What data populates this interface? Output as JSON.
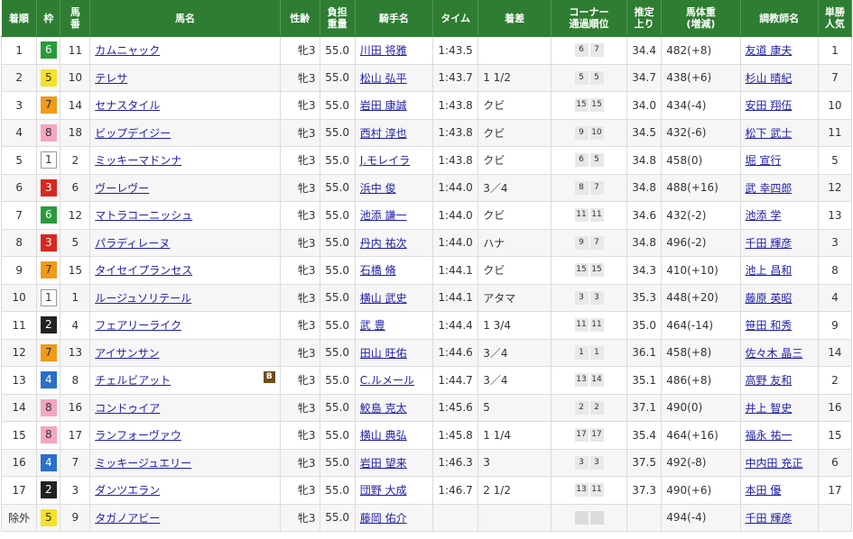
{
  "headers": {
    "rank": "着順",
    "waku": "枠",
    "umaban": "馬番",
    "horse": "馬名",
    "sex_age": "性齢",
    "weight_carried": "負担重量",
    "jockey": "騎手名",
    "time": "タイム",
    "margin": "着差",
    "corner": "コーナー通過順位",
    "last3f": "推定上り",
    "body_weight": "馬体重(増減)",
    "trainer": "調教師名",
    "popularity": "単勝人気"
  },
  "waku_colors": {
    "1": {
      "bg": "#ffffff",
      "fg": "#333333",
      "border": "#999999"
    },
    "2": {
      "bg": "#222222",
      "fg": "#ffffff",
      "border": "#222222"
    },
    "3": {
      "bg": "#d8281f",
      "fg": "#ffffff",
      "border": "#d8281f"
    },
    "4": {
      "bg": "#2a6fc9",
      "fg": "#ffffff",
      "border": "#2a6fc9"
    },
    "5": {
      "bg": "#f5e02a",
      "fg": "#333333",
      "border": "#f5e02a"
    },
    "6": {
      "bg": "#2a9a3a",
      "fg": "#ffffff",
      "border": "#2a9a3a"
    },
    "7": {
      "bg": "#f09a1a",
      "fg": "#333333",
      "border": "#f09a1a"
    },
    "8": {
      "bg": "#f4a6bf",
      "fg": "#333333",
      "border": "#f4a6bf"
    }
  },
  "rows": [
    {
      "rank": "1",
      "waku": "6",
      "umaban": "11",
      "horse": "カムニャック",
      "blinker": "",
      "sex_age": "牝3",
      "weight": "55.0",
      "jockey": "川田 将雅",
      "time": "1:43.5",
      "margin": "",
      "corner": [
        "6",
        "7"
      ],
      "last3f": "34.4",
      "body_weight": "482(+8)",
      "trainer": "友道 康夫",
      "pop": "1"
    },
    {
      "rank": "2",
      "waku": "5",
      "umaban": "10",
      "horse": "テレサ",
      "blinker": "",
      "sex_age": "牝3",
      "weight": "55.0",
      "jockey": "松山 弘平",
      "time": "1:43.7",
      "margin": "1 1/2",
      "corner": [
        "5",
        "5"
      ],
      "last3f": "34.7",
      "body_weight": "438(+6)",
      "trainer": "杉山 晴紀",
      "pop": "7"
    },
    {
      "rank": "3",
      "waku": "7",
      "umaban": "14",
      "horse": "セナスタイル",
      "blinker": "",
      "sex_age": "牝3",
      "weight": "55.0",
      "jockey": "岩田 康誠",
      "time": "1:43.8",
      "margin": "クビ",
      "corner": [
        "15",
        "15"
      ],
      "last3f": "34.0",
      "body_weight": "434(-4)",
      "trainer": "安田 翔伍",
      "pop": "10"
    },
    {
      "rank": "4",
      "waku": "8",
      "umaban": "18",
      "horse": "ビップデイジー",
      "blinker": "",
      "sex_age": "牝3",
      "weight": "55.0",
      "jockey": "西村 淳也",
      "time": "1:43.8",
      "margin": "クビ",
      "corner": [
        "9",
        "10"
      ],
      "last3f": "34.5",
      "body_weight": "432(-6)",
      "trainer": "松下 武士",
      "pop": "11"
    },
    {
      "rank": "5",
      "waku": "1",
      "umaban": "2",
      "horse": "ミッキーマドンナ",
      "blinker": "",
      "sex_age": "牝3",
      "weight": "55.0",
      "jockey": "J.モレイラ",
      "time": "1:43.8",
      "margin": "クビ",
      "corner": [
        "6",
        "5"
      ],
      "last3f": "34.8",
      "body_weight": "458(0)",
      "trainer": "堀 宣行",
      "pop": "5"
    },
    {
      "rank": "6",
      "waku": "3",
      "umaban": "6",
      "horse": "ヴーレヴー",
      "blinker": "",
      "sex_age": "牝3",
      "weight": "55.0",
      "jockey": "浜中 俊",
      "time": "1:44.0",
      "margin": "3／4",
      "corner": [
        "8",
        "7"
      ],
      "last3f": "34.8",
      "body_weight": "488(+16)",
      "trainer": "武 幸四郎",
      "pop": "12"
    },
    {
      "rank": "7",
      "waku": "6",
      "umaban": "12",
      "horse": "マトラコーニッシュ",
      "blinker": "",
      "sex_age": "牝3",
      "weight": "55.0",
      "jockey": "池添 謙一",
      "time": "1:44.0",
      "margin": "クビ",
      "corner": [
        "11",
        "11"
      ],
      "last3f": "34.6",
      "body_weight": "432(-2)",
      "trainer": "池添 学",
      "pop": "13"
    },
    {
      "rank": "8",
      "waku": "3",
      "umaban": "5",
      "horse": "パラディレーヌ",
      "blinker": "",
      "sex_age": "牝3",
      "weight": "55.0",
      "jockey": "丹内 祐次",
      "time": "1:44.0",
      "margin": "ハナ",
      "corner": [
        "9",
        "7"
      ],
      "last3f": "34.8",
      "body_weight": "496(-2)",
      "trainer": "千田 輝彦",
      "pop": "3"
    },
    {
      "rank": "9",
      "waku": "7",
      "umaban": "15",
      "horse": "タイセイプランセス",
      "blinker": "",
      "sex_age": "牝3",
      "weight": "55.0",
      "jockey": "石橋 脩",
      "time": "1:44.1",
      "margin": "クビ",
      "corner": [
        "15",
        "15"
      ],
      "last3f": "34.3",
      "body_weight": "410(+10)",
      "trainer": "池上 昌和",
      "pop": "8"
    },
    {
      "rank": "10",
      "waku": "1",
      "umaban": "1",
      "horse": "ルージュソリテール",
      "blinker": "",
      "sex_age": "牝3",
      "weight": "55.0",
      "jockey": "横山 武史",
      "time": "1:44.1",
      "margin": "アタマ",
      "corner": [
        "3",
        "3"
      ],
      "last3f": "35.3",
      "body_weight": "448(+20)",
      "trainer": "藤原 英昭",
      "pop": "4"
    },
    {
      "rank": "11",
      "waku": "2",
      "umaban": "4",
      "horse": "フェアリーライク",
      "blinker": "",
      "sex_age": "牝3",
      "weight": "55.0",
      "jockey": "武 豊",
      "time": "1:44.4",
      "margin": "1 3/4",
      "corner": [
        "11",
        "11"
      ],
      "last3f": "35.0",
      "body_weight": "464(-14)",
      "trainer": "笹田 和秀",
      "pop": "9"
    },
    {
      "rank": "12",
      "waku": "7",
      "umaban": "13",
      "horse": "アイサンサン",
      "blinker": "",
      "sex_age": "牝3",
      "weight": "55.0",
      "jockey": "田山 旺佑",
      "time": "1:44.6",
      "margin": "3／4",
      "corner": [
        "1",
        "1"
      ],
      "last3f": "36.1",
      "body_weight": "458(+8)",
      "trainer": "佐々木 晶三",
      "pop": "14"
    },
    {
      "rank": "13",
      "waku": "4",
      "umaban": "8",
      "horse": "チェルビアット",
      "blinker": "B",
      "sex_age": "牝3",
      "weight": "55.0",
      "jockey": "C.ルメール",
      "time": "1:44.7",
      "margin": "3／4",
      "corner": [
        "13",
        "14"
      ],
      "last3f": "35.1",
      "body_weight": "486(+8)",
      "trainer": "高野 友和",
      "pop": "2"
    },
    {
      "rank": "14",
      "waku": "8",
      "umaban": "16",
      "horse": "コンドゥイア",
      "blinker": "",
      "sex_age": "牝3",
      "weight": "55.0",
      "jockey": "鮫島 克太",
      "time": "1:45.6",
      "margin": "5",
      "corner": [
        "2",
        "2"
      ],
      "last3f": "37.1",
      "body_weight": "490(0)",
      "trainer": "井上 智史",
      "pop": "16"
    },
    {
      "rank": "15",
      "waku": "8",
      "umaban": "17",
      "horse": "ランフォーヴァウ",
      "blinker": "",
      "sex_age": "牝3",
      "weight": "55.0",
      "jockey": "横山 典弘",
      "time": "1:45.8",
      "margin": "1 1/4",
      "corner": [
        "17",
        "17"
      ],
      "last3f": "35.4",
      "body_weight": "464(+16)",
      "trainer": "福永 祐一",
      "pop": "15"
    },
    {
      "rank": "16",
      "waku": "4",
      "umaban": "7",
      "horse": "ミッキージュエリー",
      "blinker": "",
      "sex_age": "牝3",
      "weight": "55.0",
      "jockey": "岩田 望来",
      "time": "1:46.3",
      "margin": "3",
      "corner": [
        "3",
        "3"
      ],
      "last3f": "37.5",
      "body_weight": "492(-8)",
      "trainer": "中内田 充正",
      "pop": "6"
    },
    {
      "rank": "17",
      "waku": "2",
      "umaban": "3",
      "horse": "ダンツエラン",
      "blinker": "",
      "sex_age": "牝3",
      "weight": "55.0",
      "jockey": "団野 大成",
      "time": "1:46.7",
      "margin": "2 1/2",
      "corner": [
        "13",
        "11"
      ],
      "last3f": "37.3",
      "body_weight": "490(+6)",
      "trainer": "本田 優",
      "pop": "17"
    },
    {
      "rank": "除外",
      "waku": "5",
      "umaban": "9",
      "horse": "タガノアビー",
      "blinker": "",
      "sex_age": "牝3",
      "weight": "55.0",
      "jockey": "藤岡 佑介",
      "time": "",
      "margin": "",
      "corner": [
        "",
        ""
      ],
      "last3f": "",
      "body_weight": "494(-4)",
      "trainer": "千田 輝彦",
      "pop": ""
    }
  ]
}
